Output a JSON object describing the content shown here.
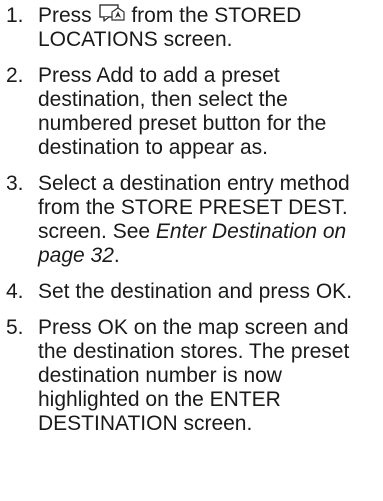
{
  "steps": [
    {
      "number": "1.",
      "before_icon": "Press ",
      "icon": "stored-location-icon",
      "after_icon": " from the STORED LOCATIONS screen."
    },
    {
      "number": "2.",
      "text": "Press Add to add a preset destination, then select the numbered preset button for the destination to appear as."
    },
    {
      "number": "3.",
      "text": "Select a destination entry method from the STORE PRESET DEST. screen. See ",
      "link_text": "Enter Destination on page 32",
      "after_link": "."
    },
    {
      "number": "4.",
      "text": "Set the destination and press OK."
    },
    {
      "number": "5.",
      "text": "Press OK on the map screen and the destination stores. The preset destination number is now highlighted on the ENTER DESTINATION screen."
    }
  ]
}
